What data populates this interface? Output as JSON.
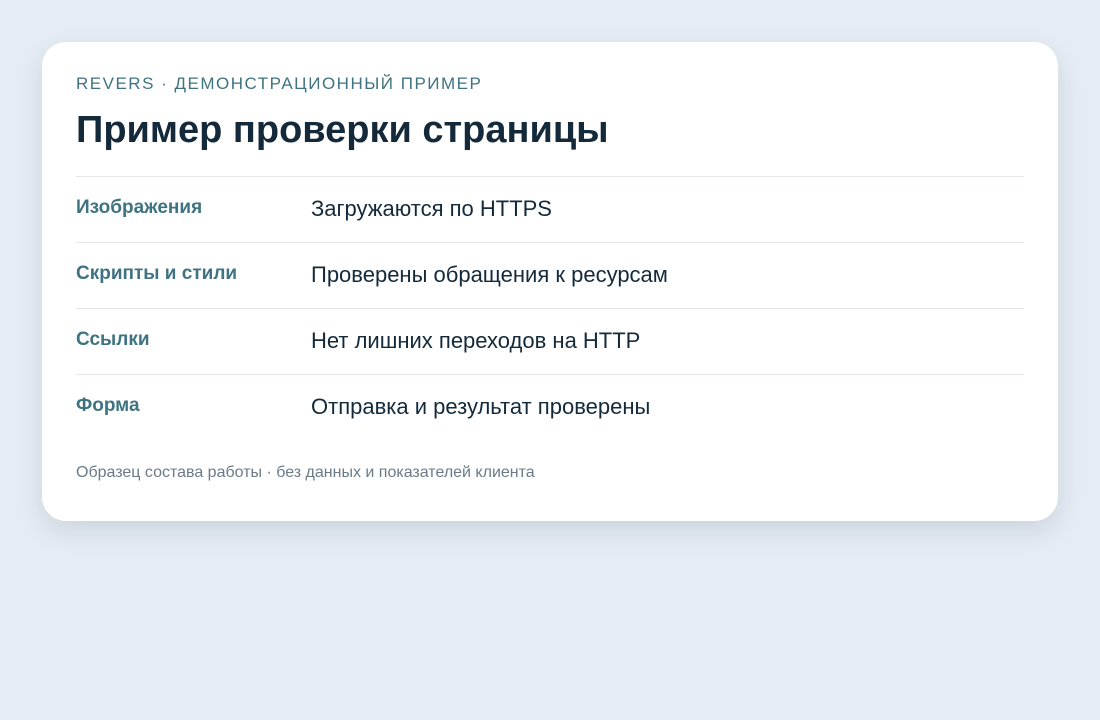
{
  "card": {
    "eyebrow": "REVERS · ДЕМОНСТРАЦИОННЫЙ ПРИМЕР",
    "title": "Пример проверки страницы",
    "rows": [
      {
        "label": "Изображения",
        "value": "Загружаются по HTTPS"
      },
      {
        "label": "Скрипты и стили",
        "value": "Проверены обращения к ресурсам"
      },
      {
        "label": "Ссылки",
        "value": "Нет лишних переходов на HTTP"
      },
      {
        "label": "Форма",
        "value": "Отправка и результат проверены"
      }
    ],
    "footnote": "Образец состава работы · без данных и показателей клиента"
  }
}
